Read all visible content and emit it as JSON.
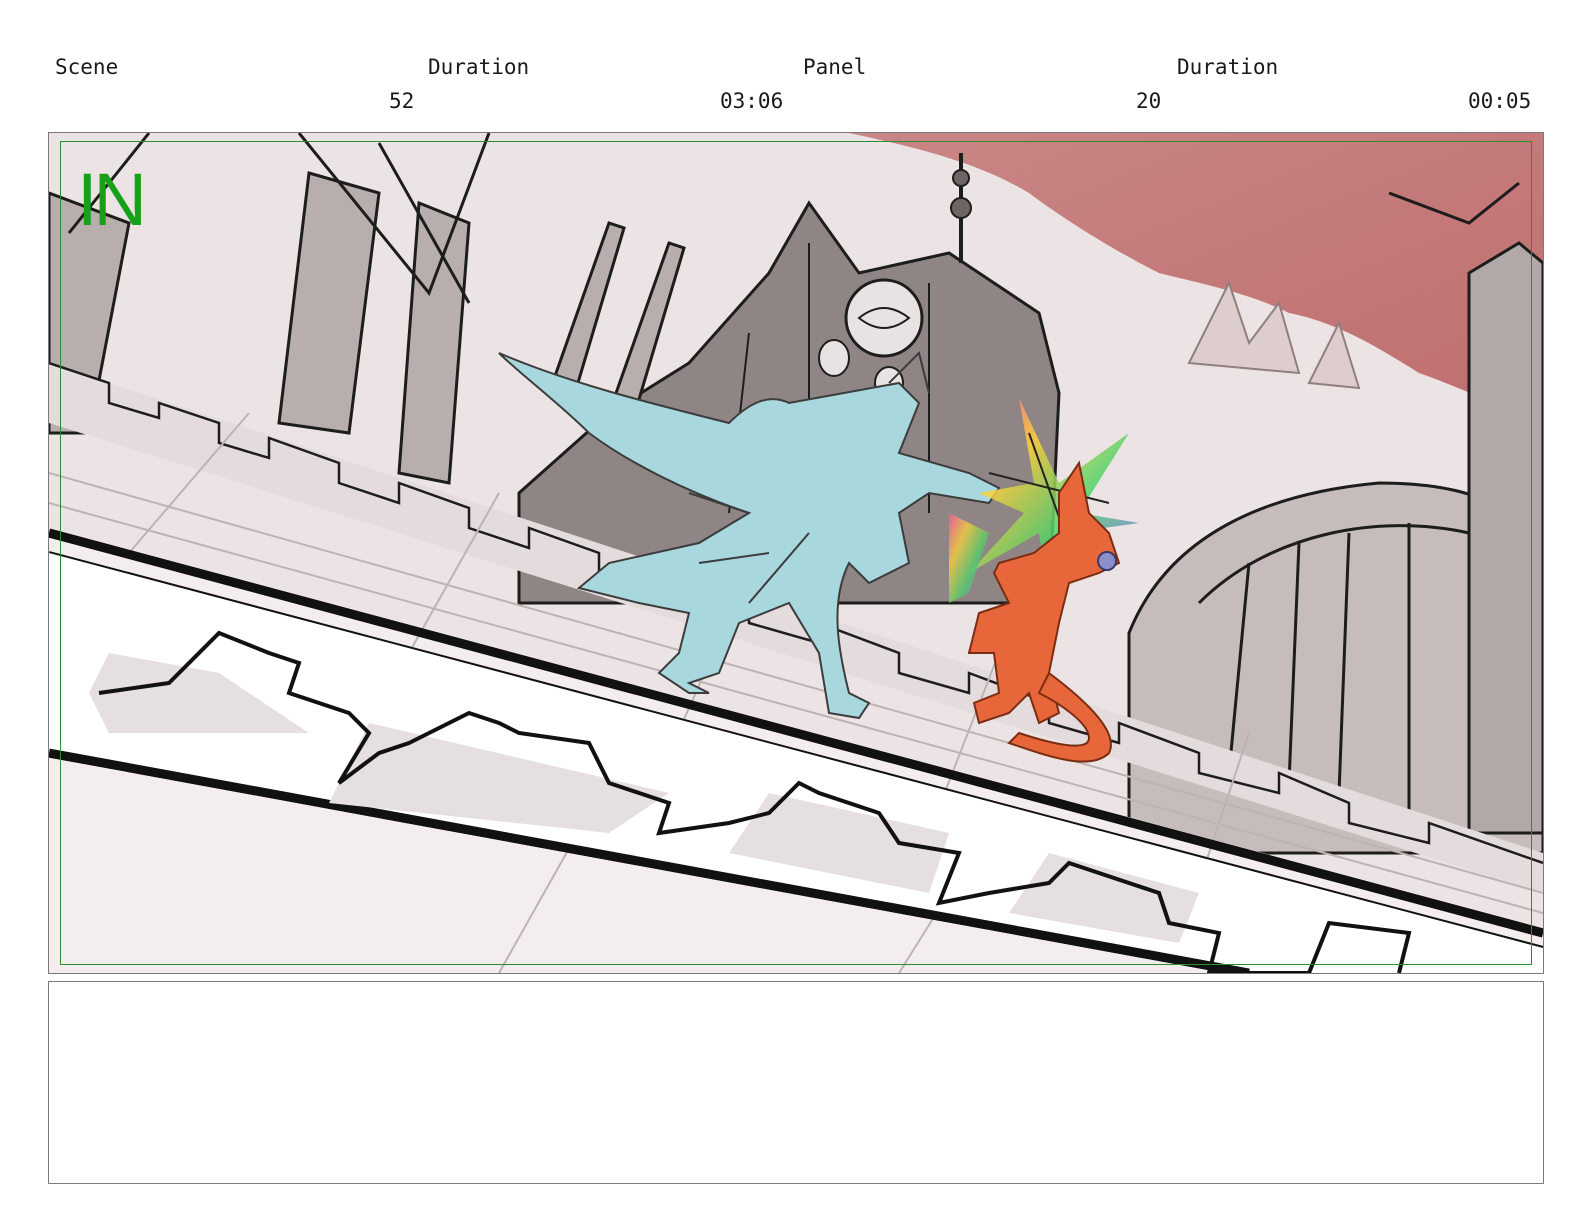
{
  "header": {
    "scene_label": "Scene",
    "scene_duration_label": "Duration",
    "panel_label": "Panel",
    "panel_duration_label": "Duration",
    "scene_number": "52",
    "scene_duration": "03:06",
    "panel_number": "20",
    "panel_duration": "00:05"
  },
  "panel": {
    "transition_label": "IN",
    "transition_color": "#18a018",
    "safe_area_color": "#2e8b2e",
    "sky_color": "#c77a7a",
    "character_left_color": "#a8d8de",
    "character_right_color": "#e8673a"
  },
  "notes": {
    "text": ""
  }
}
